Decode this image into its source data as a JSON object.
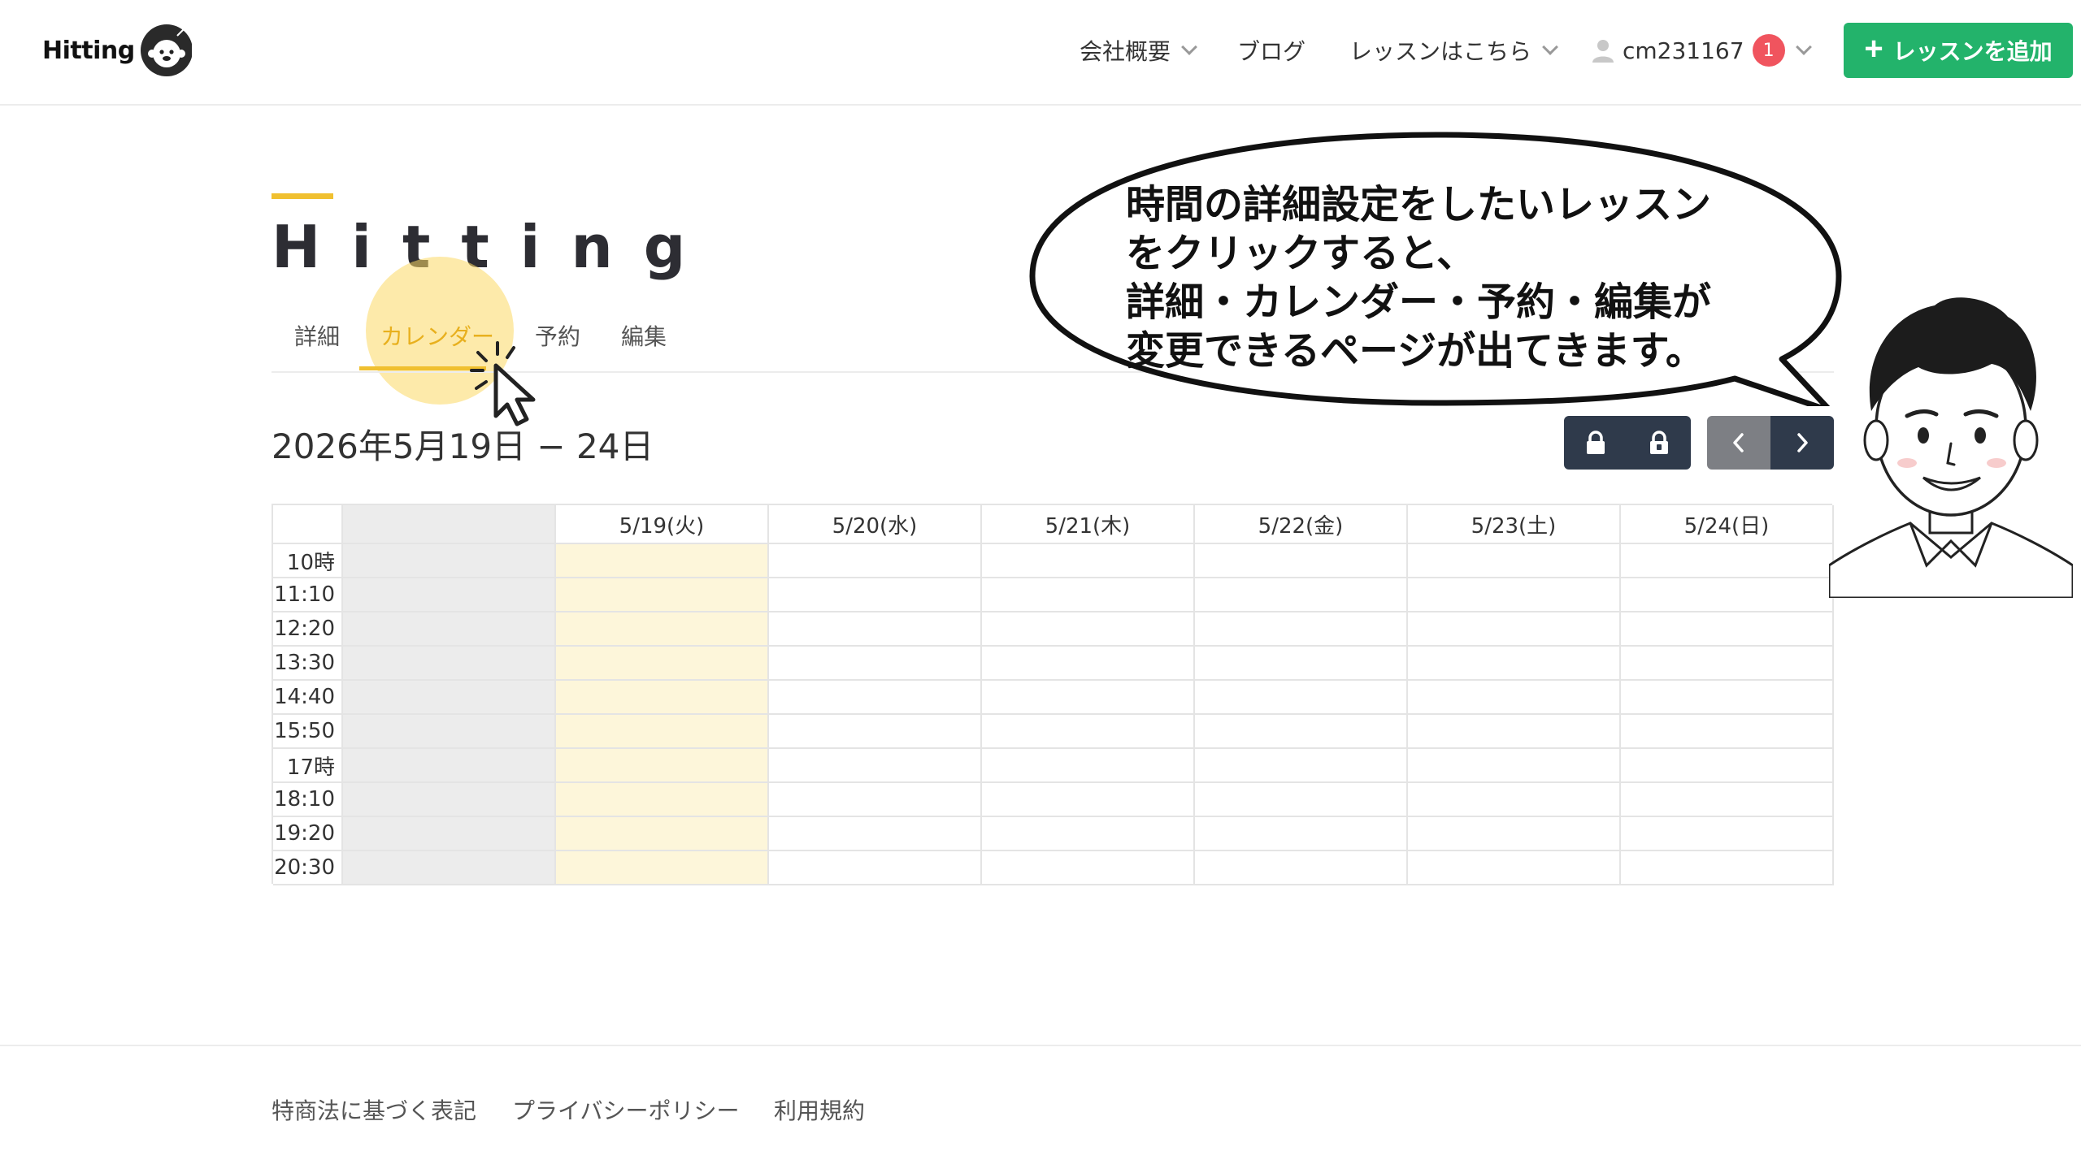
{
  "header": {
    "logo_text": "Hitting",
    "nav": {
      "company": "会社概要",
      "blog": "ブログ",
      "lessons": "レッスンはこちら",
      "user": "cm231167",
      "notification_count": "1"
    },
    "add_lesson_label": "レッスンを追加"
  },
  "page": {
    "title": "Hitting",
    "tabs": [
      "詳細",
      "カレンダー",
      "予約",
      "編集"
    ],
    "active_tab": "カレンダー",
    "date_range": "2026年5月19日 − 24日"
  },
  "calendar": {
    "days": [
      "5/19(火)",
      "5/20(水)",
      "5/21(木)",
      "5/22(金)",
      "5/23(土)",
      "5/24(日)"
    ],
    "times": [
      "10時",
      "11:10",
      "12:20",
      "13:30",
      "14:40",
      "15:50",
      "17時",
      "18:10",
      "19:20",
      "20:30"
    ],
    "highlight_color": "#fdf6da",
    "blocked_color": "#ececec"
  },
  "callout": {
    "lines": [
      "時間の詳細設定をしたいレッスン",
      "をクリックすると、",
      "詳細・カレンダー・予約・編集が",
      "変更できるページが出てきます。"
    ]
  },
  "footer": {
    "links": [
      "特商法に基づく表記",
      "プライバシーポリシー",
      "利用規約"
    ]
  },
  "colors": {
    "accent": "#f0c030",
    "add_button": "#23b36b",
    "badge": "#f0545e",
    "toolbar_button": "#2f3a4b"
  }
}
